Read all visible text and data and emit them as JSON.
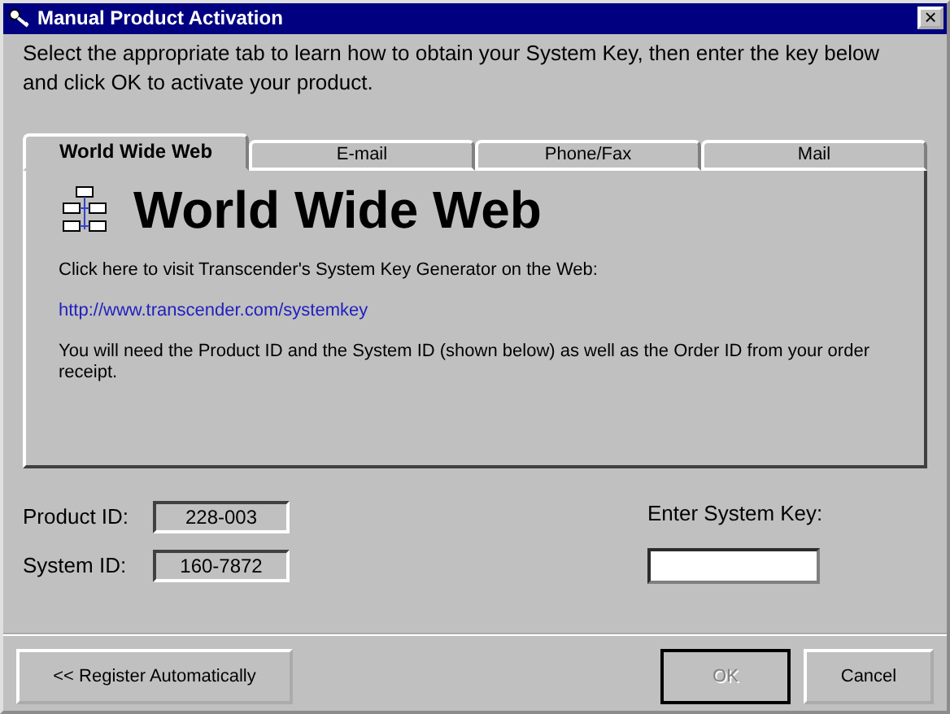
{
  "window": {
    "title": "Manual Product Activation",
    "close": "×"
  },
  "instructions": "Select the appropriate tab to learn how to obtain your System Key, then enter the key below and click OK to activate your product.",
  "tabs": [
    {
      "label": "World Wide Web",
      "selected": true
    },
    {
      "label": "E-mail",
      "selected": false
    },
    {
      "label": "Phone/Fax",
      "selected": false
    },
    {
      "label": "Mail",
      "selected": false
    }
  ],
  "panel": {
    "heading": "World Wide Web",
    "intro": "Click here to visit Transcender's System Key Generator on the Web:",
    "link": "http://www.transcender.com/systemkey",
    "note": "You will need the Product ID and the System ID (shown below) as well as the Order ID from your order receipt."
  },
  "ids": [
    {
      "label": "Product ID:",
      "value": "228-003"
    },
    {
      "label": "System ID:",
      "value": "160-7872"
    }
  ],
  "system_key": {
    "label": "Enter System Key:"
  },
  "buttons": [
    {
      "label": "<< Register Automatically",
      "disabled": false
    },
    {
      "label": "OK",
      "disabled": true
    },
    {
      "label": "Cancel",
      "disabled": false
    }
  ]
}
